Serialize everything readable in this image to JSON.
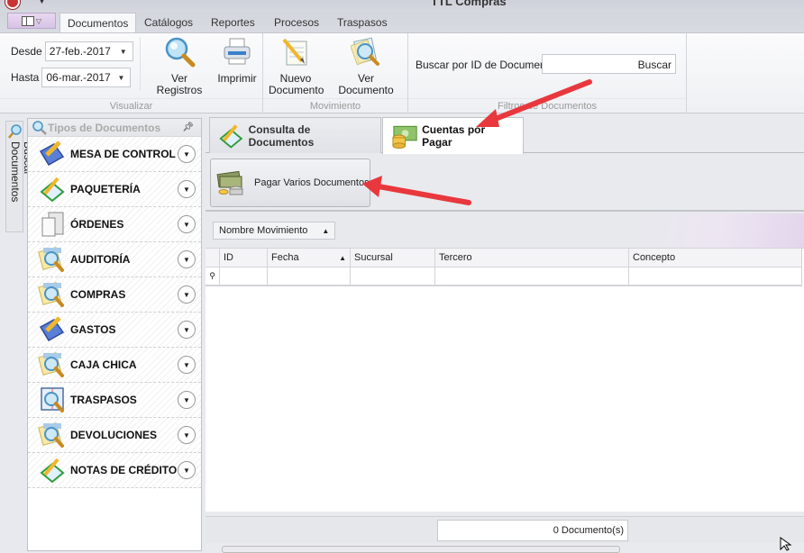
{
  "window": {
    "title": "TTL Compras"
  },
  "ribbon_tabs": [
    {
      "label": "Documentos",
      "active": true
    },
    {
      "label": "Catálogos"
    },
    {
      "label": "Reportes"
    },
    {
      "label": "Procesos"
    },
    {
      "label": "Traspasos"
    }
  ],
  "ribbon": {
    "visualizar": {
      "label": "Visualizar",
      "desde_label": "Desde",
      "desde_value": "27-feb.-2017",
      "hasta_label": "Hasta",
      "hasta_value": "06-mar.-2017",
      "ver_registros": "Ver Registros",
      "imprimir": "Imprimir"
    },
    "movimiento": {
      "label": "Movimiento",
      "nuevo_documento": "Nuevo Documento",
      "ver_documento": "Ver Documento"
    },
    "filtros": {
      "label": "Filtros de Documentos",
      "search_label": "Buscar por ID de Documento",
      "search_value": "",
      "search_button": "Buscar"
    }
  },
  "side_strip": {
    "label": "Buscar Documentos"
  },
  "panel": {
    "title": "Tipos de Documentos",
    "items": [
      {
        "label": "MESA DE CONTROL",
        "icon": "folder-pencil"
      },
      {
        "label": "PAQUETERÍA",
        "icon": "notebook-pencil"
      },
      {
        "label": "ÓRDENES",
        "icon": "documents"
      },
      {
        "label": "AUDITORÍA",
        "icon": "doc-search"
      },
      {
        "label": "COMPRAS",
        "icon": "doc-search"
      },
      {
        "label": "GASTOS",
        "icon": "folder-pencil"
      },
      {
        "label": "CAJA CHICA",
        "icon": "doc-search"
      },
      {
        "label": "TRASPASOS",
        "icon": "book-search"
      },
      {
        "label": "DEVOLUCIONES",
        "icon": "doc-search"
      },
      {
        "label": "NOTAS DE CRÉDITO",
        "icon": "notebook-pencil"
      }
    ]
  },
  "doc_tabs": [
    {
      "label": "Consulta de Documentos",
      "active": false
    },
    {
      "label": "Cuentas por Pagar",
      "active": true
    }
  ],
  "toolbar": {
    "pagar_varios": "Pagar Varios Documentos"
  },
  "grid": {
    "group_by": "Nombre Movimiento",
    "columns": [
      "ID",
      "Fecha",
      "Sucursal",
      "Tercero",
      "Concepto"
    ],
    "sorted_column": "Fecha",
    "rows": []
  },
  "status": {
    "count": "0 Documento(s)"
  },
  "colors": {
    "annotation_arrow": "#e8383d",
    "app_menu": "#d8c3e6"
  }
}
